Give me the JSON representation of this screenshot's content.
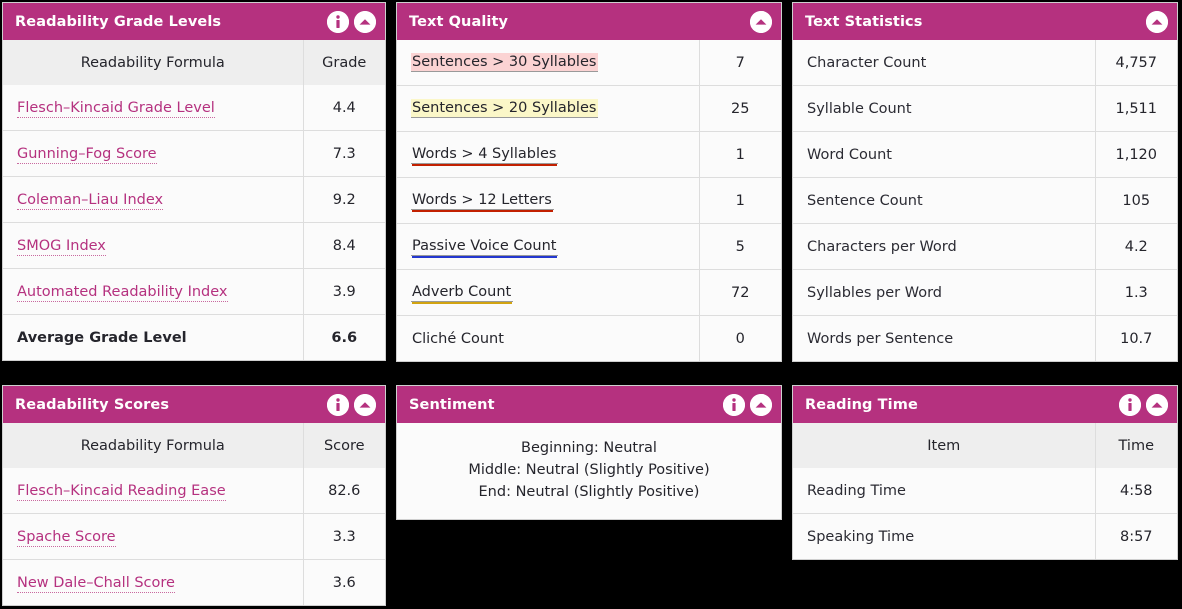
{
  "icons": {
    "info": "info-icon",
    "collapse": "chevron-up-icon"
  },
  "panels": {
    "grade_levels": {
      "title": "Readability Grade Levels",
      "headers": {
        "label": "Readability Formula",
        "value": "Grade"
      },
      "rows": [
        {
          "label": "Flesch–Kincaid Grade Level",
          "value": "4.4"
        },
        {
          "label": "Gunning–Fog Score",
          "value": "7.3"
        },
        {
          "label": "Coleman–Liau Index",
          "value": "9.2"
        },
        {
          "label": "SMOG Index",
          "value": "8.4"
        },
        {
          "label": "Automated Readability Index",
          "value": "3.9"
        }
      ],
      "summary": {
        "label": "Average Grade Level",
        "value": "6.6"
      }
    },
    "text_quality": {
      "title": "Text Quality",
      "rows": [
        {
          "label": "Sentences > 30 Syllables",
          "value": "7",
          "style": "hl-pink"
        },
        {
          "label": "Sentences > 20 Syllables",
          "value": "25",
          "style": "hl-yellow"
        },
        {
          "label": "Words > 4 Syllables",
          "value": "1",
          "style": "ul-red"
        },
        {
          "label": "Words > 12 Letters",
          "value": "1",
          "style": "ul-red"
        },
        {
          "label": "Passive Voice Count",
          "value": "5",
          "style": "ul-blue"
        },
        {
          "label": "Adverb Count",
          "value": "72",
          "style": "ul-gold"
        },
        {
          "label": "Cliché Count",
          "value": "0",
          "style": "plain"
        }
      ]
    },
    "text_statistics": {
      "title": "Text Statistics",
      "rows": [
        {
          "label": "Character Count",
          "value": "4,757"
        },
        {
          "label": "Syllable Count",
          "value": "1,511"
        },
        {
          "label": "Word Count",
          "value": "1,120"
        },
        {
          "label": "Sentence Count",
          "value": "105"
        },
        {
          "label": "Characters per Word",
          "value": "4.2"
        },
        {
          "label": "Syllables per Word",
          "value": "1.3"
        },
        {
          "label": "Words per Sentence",
          "value": "10.7"
        }
      ]
    },
    "readability_scores": {
      "title": "Readability Scores",
      "headers": {
        "label": "Readability Formula",
        "value": "Score"
      },
      "rows": [
        {
          "label": "Flesch–Kincaid Reading Ease",
          "value": "82.6"
        },
        {
          "label": "Spache Score",
          "value": "3.3"
        },
        {
          "label": "New Dale–Chall Score",
          "value": "3.6"
        }
      ]
    },
    "sentiment": {
      "title": "Sentiment",
      "lines": [
        "Beginning: Neutral",
        "Middle: Neutral (Slightly Positive)",
        "End: Neutral (Slightly Positive)"
      ]
    },
    "reading_time": {
      "title": "Reading Time",
      "headers": {
        "label": "Item",
        "value": "Time"
      },
      "rows": [
        {
          "label": "Reading Time",
          "value": "4:58"
        },
        {
          "label": "Speaking Time",
          "value": "8:57"
        }
      ]
    }
  },
  "colors": {
    "header_bg": "#b5317f",
    "link": "#b5317f",
    "highlight_pink": "#fbd3d3",
    "highlight_yellow": "#fbf7c8",
    "underline_red": "#c22000",
    "underline_blue": "#2438cf",
    "underline_gold": "#d2a411"
  }
}
